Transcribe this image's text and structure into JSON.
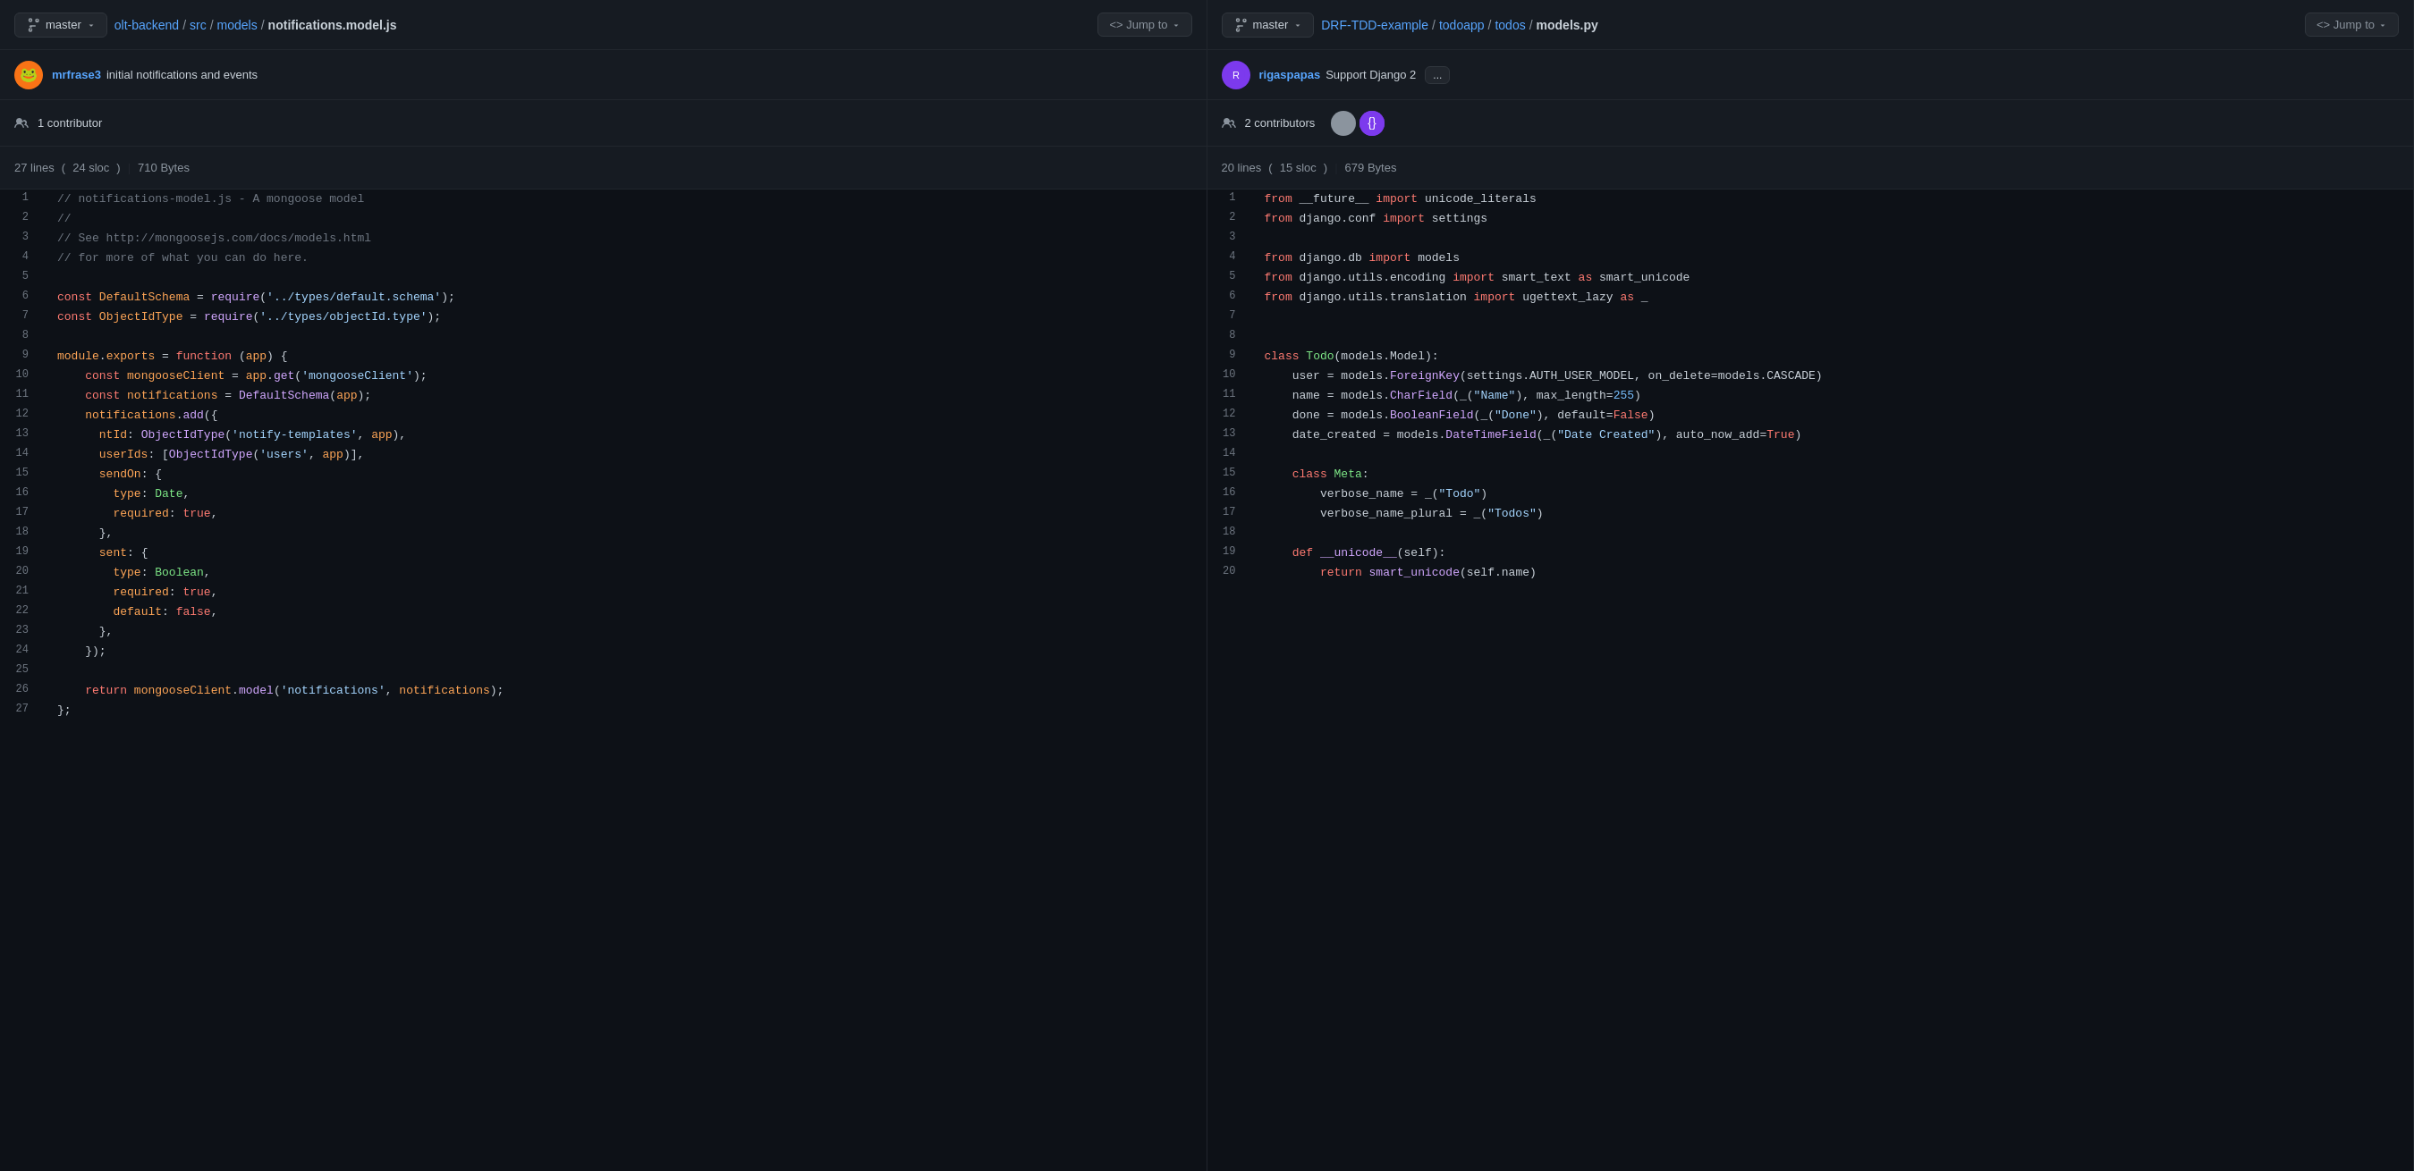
{
  "panels": [
    {
      "id": "left",
      "branch": "master",
      "breadcrumb": {
        "parts": [
          "olt-backend",
          "src",
          "models"
        ],
        "filename": "notifications.model.js",
        "jumpto": "<> Jump to"
      },
      "commit": {
        "author": "mrfrase3",
        "message": "initial notifications and events"
      },
      "contributors": {
        "count": "1 contributor",
        "avatars": []
      },
      "fileinfo": {
        "lines": "27 lines",
        "sloc": "24 sloc",
        "size": "710 Bytes"
      },
      "code": [
        {
          "n": 1,
          "text": "// notifications-model.js - A mongoose model",
          "type": "comment"
        },
        {
          "n": 2,
          "text": "//",
          "type": "comment"
        },
        {
          "n": 3,
          "text": "// See http://mongoosejs.com/docs/models.html",
          "type": "comment"
        },
        {
          "n": 4,
          "text": "// for more of what you can do here.",
          "type": "comment"
        },
        {
          "n": 5,
          "text": "",
          "type": "blank"
        },
        {
          "n": 6,
          "text": "const DefaultSchema = require('../types/default.schema');",
          "type": "code"
        },
        {
          "n": 7,
          "text": "const ObjectIdType = require('../types/objectId.type');",
          "type": "code"
        },
        {
          "n": 8,
          "text": "",
          "type": "blank"
        },
        {
          "n": 9,
          "text": "module.exports = function (app) {",
          "type": "code"
        },
        {
          "n": 10,
          "text": "    const mongooseClient = app.get('mongooseClient');",
          "type": "code"
        },
        {
          "n": 11,
          "text": "    const notifications = DefaultSchema(app);",
          "type": "code"
        },
        {
          "n": 12,
          "text": "    notifications.add({",
          "type": "code"
        },
        {
          "n": 13,
          "text": "      ntId: ObjectIdType('notify-templates', app),",
          "type": "code"
        },
        {
          "n": 14,
          "text": "      userIds: [ObjectIdType('users', app)],",
          "type": "code"
        },
        {
          "n": 15,
          "text": "      sendOn: {",
          "type": "code"
        },
        {
          "n": 16,
          "text": "        type: Date,",
          "type": "code"
        },
        {
          "n": 17,
          "text": "        required: true,",
          "type": "code"
        },
        {
          "n": 18,
          "text": "      },",
          "type": "code"
        },
        {
          "n": 19,
          "text": "      sent: {",
          "type": "code"
        },
        {
          "n": 20,
          "text": "        type: Boolean,",
          "type": "code"
        },
        {
          "n": 21,
          "text": "        required: true,",
          "type": "code"
        },
        {
          "n": 22,
          "text": "        default: false,",
          "type": "code"
        },
        {
          "n": 23,
          "text": "      },",
          "type": "code"
        },
        {
          "n": 24,
          "text": "    });",
          "type": "code"
        },
        {
          "n": 25,
          "text": "",
          "type": "blank"
        },
        {
          "n": 26,
          "text": "    return mongooseClient.model('notifications', notifications);",
          "type": "code"
        },
        {
          "n": 27,
          "text": "};",
          "type": "code"
        }
      ]
    },
    {
      "id": "right",
      "branch": "master",
      "breadcrumb": {
        "parts": [
          "DRF-TDD-example",
          "todoapp",
          "todos"
        ],
        "filename": "models.py",
        "jumpto": "<> Jump to"
      },
      "commit": {
        "author": "rigaspapas",
        "message": "Support Django 2",
        "dots": "..."
      },
      "contributors": {
        "count": "2 contributors",
        "avatars": [
          "gray",
          "purple"
        ]
      },
      "fileinfo": {
        "lines": "20 lines",
        "sloc": "15 sloc",
        "size": "679 Bytes"
      },
      "code": [
        {
          "n": 1,
          "text": "from __future__ import unicode_literals"
        },
        {
          "n": 2,
          "text": "from django.conf import settings"
        },
        {
          "n": 3,
          "text": ""
        },
        {
          "n": 4,
          "text": "from django.db import models"
        },
        {
          "n": 5,
          "text": "from django.utils.encoding import smart_text as smart_unicode"
        },
        {
          "n": 6,
          "text": "from django.utils.translation import ugettext_lazy as _"
        },
        {
          "n": 7,
          "text": ""
        },
        {
          "n": 8,
          "text": ""
        },
        {
          "n": 9,
          "text": "class Todo(models.Model):"
        },
        {
          "n": 10,
          "text": "    user = models.ForeignKey(settings.AUTH_USER_MODEL, on_delete=models.CASCADE)"
        },
        {
          "n": 11,
          "text": "    name = models.CharField(_(\"Name\"), max_length=255)"
        },
        {
          "n": 12,
          "text": "    done = models.BooleanField(_(\"Done\"), default=False)"
        },
        {
          "n": 13,
          "text": "    date_created = models.DateTimeField(_(\"Date Created\"), auto_now_add=True)"
        },
        {
          "n": 14,
          "text": ""
        },
        {
          "n": 15,
          "text": "    class Meta:"
        },
        {
          "n": 16,
          "text": "        verbose_name = _(\"Todo\")"
        },
        {
          "n": 17,
          "text": "        verbose_name_plural = _(\"Todos\")"
        },
        {
          "n": 18,
          "text": ""
        },
        {
          "n": 19,
          "text": "    def __unicode__(self):"
        },
        {
          "n": 20,
          "text": "        return smart_unicode(self.name)"
        }
      ]
    }
  ]
}
